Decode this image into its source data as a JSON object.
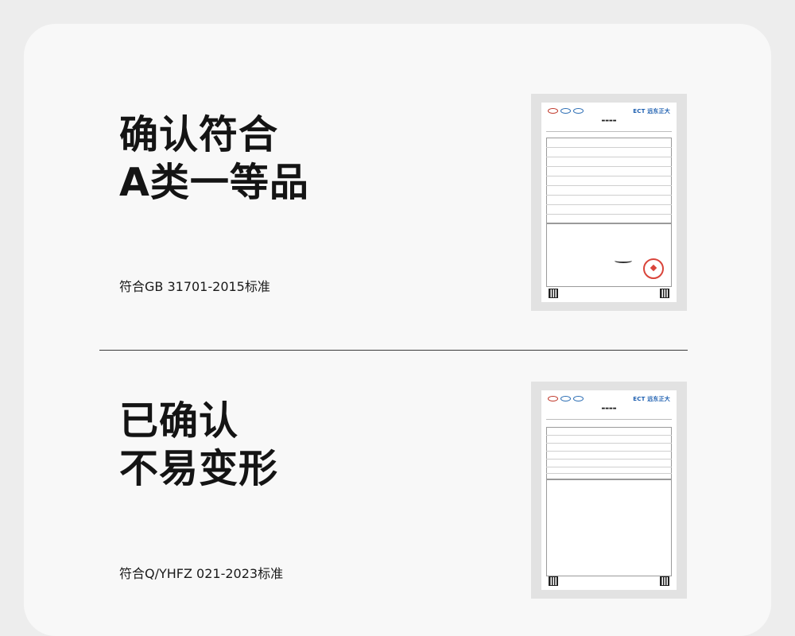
{
  "section1": {
    "headline_line1": "确认符合",
    "headline_line2": "A类一等品",
    "standard_note": "符合GB 31701-2015标准"
  },
  "section2": {
    "headline_line1": "已确认",
    "headline_line2": "不易变形",
    "standard_note": "符合Q/YHFZ 021-2023标准"
  },
  "report": {
    "brand": "ECT 远东正大"
  },
  "colors": {
    "page_background": "#ededed",
    "card_background": "#f8f8f8",
    "seal_red": "#d9443a",
    "brand_blue": "#1d5fb0"
  }
}
